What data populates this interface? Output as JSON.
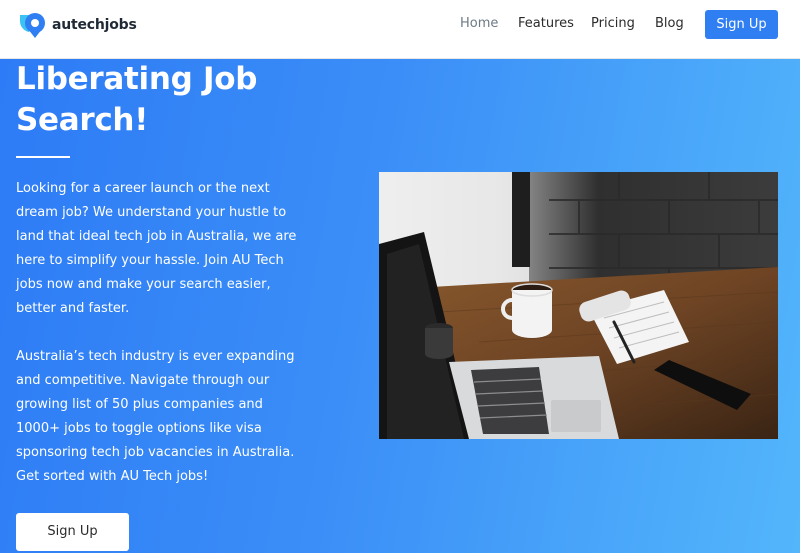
{
  "brand": {
    "name": "autechjobs"
  },
  "nav": {
    "items": [
      {
        "label": "Home",
        "active": true
      },
      {
        "label": "Features"
      },
      {
        "label": "Pricing"
      },
      {
        "label": "Blog"
      }
    ],
    "signup_label": "Sign Up"
  },
  "hero": {
    "title_line1": "Liberating Job",
    "title_line2": "Search!",
    "paragraph1": "Looking for a career launch or the next dream job? We understand your hustle to land that ideal tech job in Australia, we are here to simplify your hassle. Join AU Tech jobs now and make your search easier, better and faster.",
    "paragraph2": "Australia’s tech industry is ever expanding and competitive. Navigate through our growing list of 50 plus companies and 1000+ jobs to toggle options like visa sponsoring tech job vacancies in Australia. Get sorted with AU Tech jobs!",
    "cta_label": "Sign Up"
  },
  "colors": {
    "primary": "#2f7ff3",
    "gradient_start": "#2d7bf6",
    "gradient_end": "#53b6fb",
    "logo_blue": "#2f7ff3",
    "logo_cyan": "#3bc3f3"
  },
  "icons": {
    "logo": "location-pin-icon"
  }
}
